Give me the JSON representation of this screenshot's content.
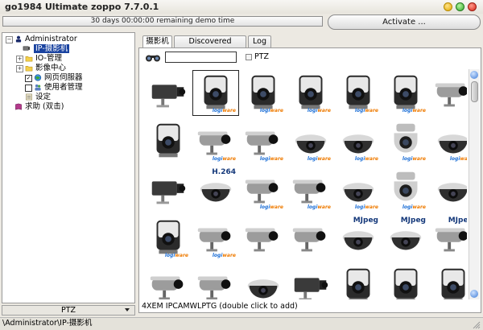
{
  "window": {
    "title": "go1984 Ultimate zoppo 7.7.0.1"
  },
  "demo": {
    "text": "30 days 00:00:00 remaining demo time",
    "activate_label": "Activate ..."
  },
  "tree": {
    "root": "Administrator",
    "items": [
      {
        "label": "IP-摄影机",
        "selected": true
      },
      {
        "label": "IO-管理"
      },
      {
        "label": "影像中心"
      },
      {
        "label": "网页伺服器"
      },
      {
        "label": "使用者管理"
      },
      {
        "label": "设定"
      }
    ],
    "help": "求助 (双击)"
  },
  "ptz_dropdown": {
    "selected": "PTZ"
  },
  "status": {
    "path": "\\Administrator\\IP-摄影机"
  },
  "tabs": [
    {
      "label": "摄影机"
    },
    {
      "label": "Discovered Cameras"
    },
    {
      "label": "Log"
    }
  ],
  "search": {
    "value": "",
    "ptz_label": "PTZ"
  },
  "grid": {
    "brand_prefix": "logi",
    "brand_suffix": "ware",
    "badges": [
      "H.264",
      "MJpeg",
      "MJpeg",
      "MJpeg"
    ]
  },
  "hint": "4XEM IPCAMWLPTG (double click to add)"
}
